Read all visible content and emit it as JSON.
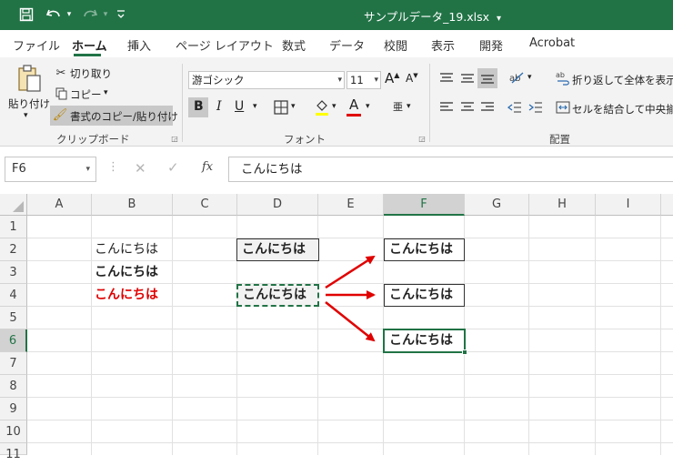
{
  "titlebar": {
    "filename": "サンプルデータ_19.xlsx",
    "title_caret": "▾",
    "save_icon": "save-icon",
    "undo_icon": "undo-icon",
    "redo_icon": "redo-icon",
    "customize_icon": "customize-qat-icon"
  },
  "menu": {
    "tabs": [
      {
        "label": "ファイル"
      },
      {
        "label": "ホーム"
      },
      {
        "label": "挿入"
      },
      {
        "label": "ページ レイアウト"
      },
      {
        "label": "数式"
      },
      {
        "label": "データ"
      },
      {
        "label": "校閲"
      },
      {
        "label": "表示"
      },
      {
        "label": "開発"
      },
      {
        "label": "Acrobat"
      }
    ],
    "active_tab": "ホーム"
  },
  "ribbon": {
    "clipboard": {
      "paste_label": "貼り付け",
      "paste_sub": "▾",
      "cut_label": "切り取り",
      "copy_label": "コピー",
      "copy_caret": "▾",
      "format_painter_label": "書式のコピー/貼り付け",
      "group_label": "クリップボード"
    },
    "font": {
      "font_name": "游ゴシック",
      "font_size": "11",
      "grow_label": "A",
      "shrink_label": "A",
      "bold": "B",
      "italic": "I",
      "underline": "U",
      "font_color_letter": "A",
      "phonetic": "亜",
      "group_label": "フォント"
    },
    "alignment": {
      "wrap_label": "折り返して全体を表示す",
      "merge_label": "セルを結合して中央揃え",
      "group_label": "配置"
    }
  },
  "formula_bar": {
    "name_box": "F6",
    "fx": "fx",
    "content": "こんにちは"
  },
  "sheet": {
    "columns": [
      "A",
      "B",
      "C",
      "D",
      "E",
      "F",
      "G",
      "H",
      "I"
    ],
    "rows": [
      "1",
      "2",
      "3",
      "4",
      "5",
      "6",
      "7",
      "8",
      "9",
      "10",
      "11"
    ],
    "selected_column": "F",
    "selected_row": "6",
    "cells": {
      "B2": "こんにちは",
      "B3": "こんにちは",
      "B4": "こんにちは",
      "D2": "こんにちは",
      "D4": "こんにちは",
      "F2": "こんにちは",
      "F4": "こんにちは",
      "F6": "こんにちは"
    },
    "colors": {
      "accent": "#217346",
      "red_text": "#e00000",
      "arrow": "#e00000"
    }
  }
}
